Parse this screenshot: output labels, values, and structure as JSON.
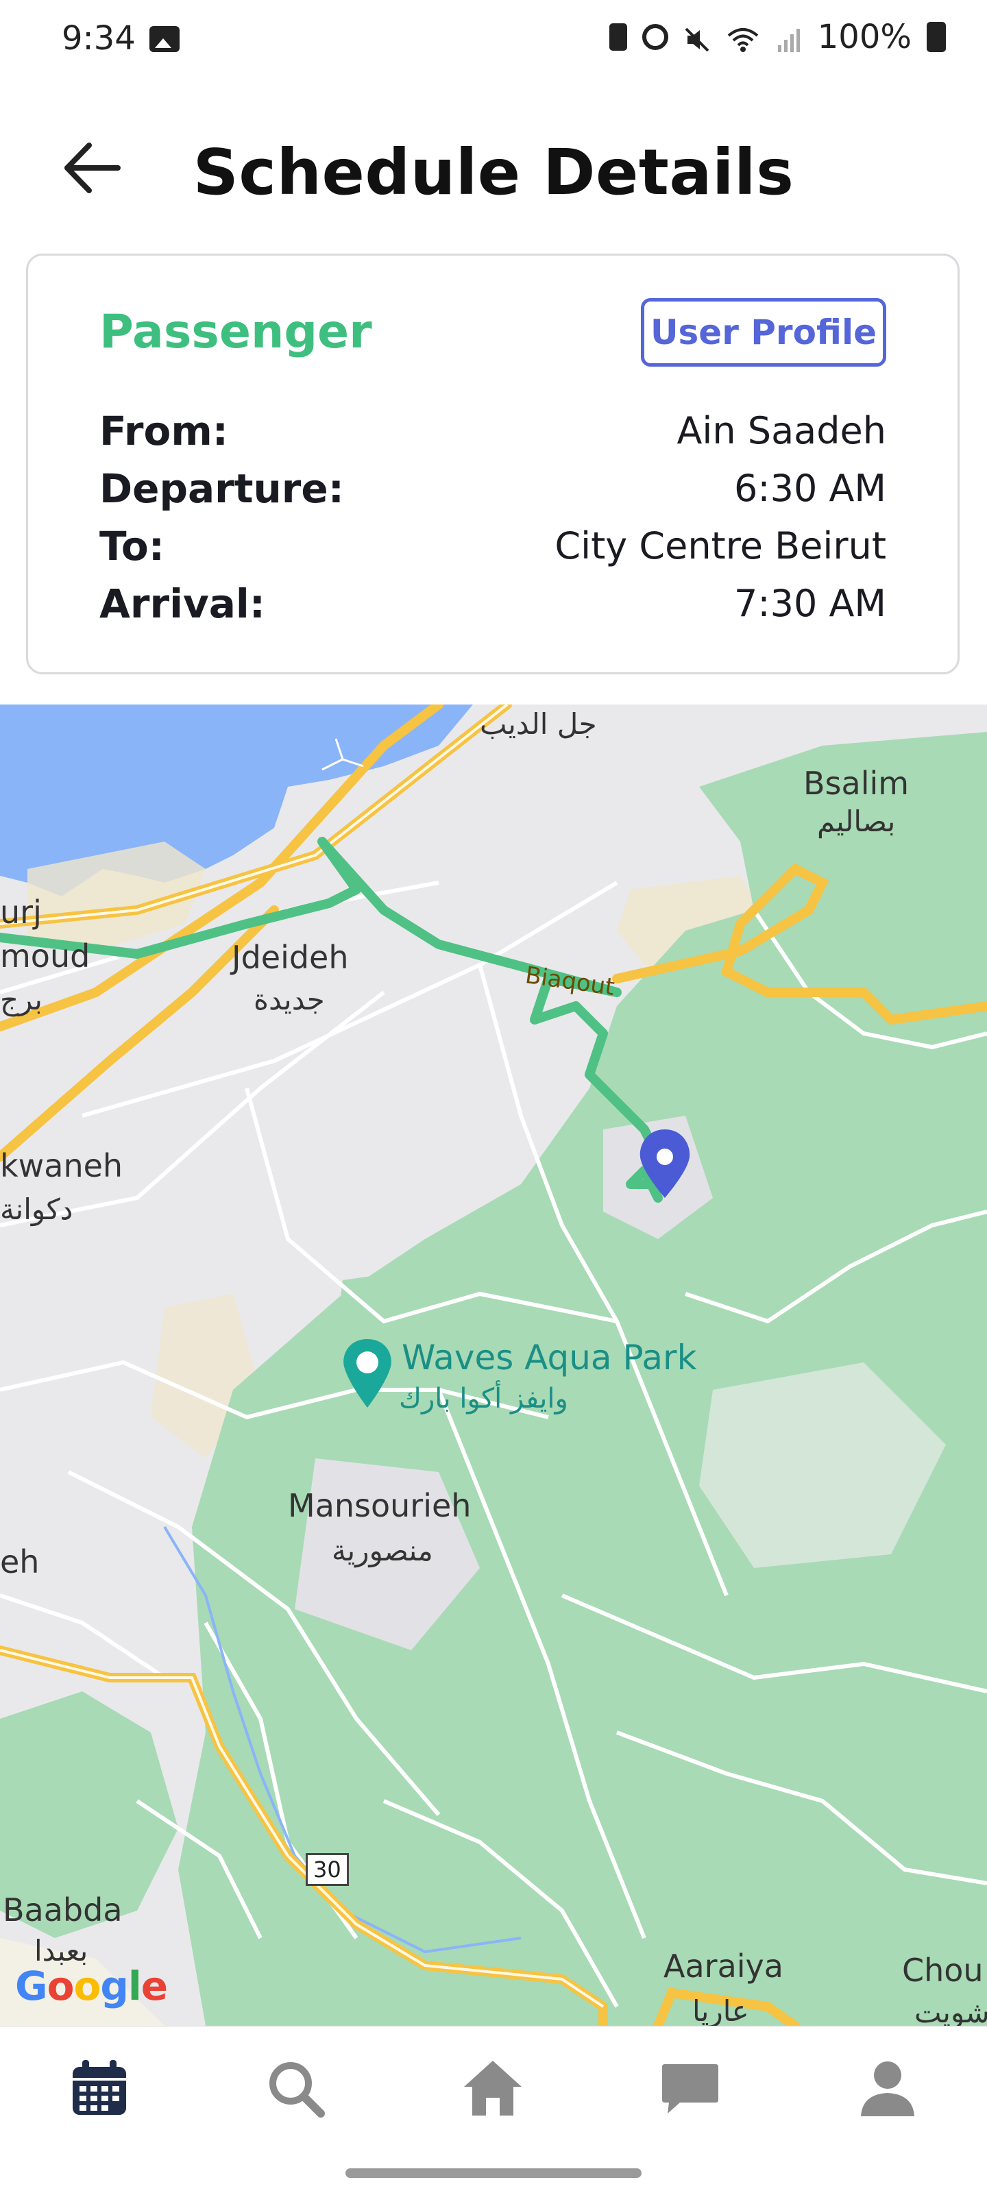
{
  "status_bar": {
    "time": "9:34",
    "battery_percent": "100%",
    "icons": [
      "gallery-icon",
      "battery-saver-icon",
      "alarm-icon",
      "mute-icon",
      "wifi-icon",
      "signal-icon",
      "battery-icon"
    ]
  },
  "header": {
    "title": "Schedule Details",
    "back_icon": "arrow-left-icon"
  },
  "card": {
    "heading": "Passenger",
    "profile_button": "User Profile",
    "rows": [
      {
        "label": "From:",
        "value": "Ain Saadeh"
      },
      {
        "label": "Departure:",
        "value": "6:30 AM"
      },
      {
        "label": "To:",
        "value": "City Centre Beirut"
      },
      {
        "label": "Arrival:",
        "value": "7:30 AM"
      }
    ]
  },
  "map": {
    "labels": {
      "jal_el_dib_ar": "جل الديب",
      "bsalim": "Bsalim",
      "bsalim_ar": "بصاليم",
      "burj_hammoud_1": "urj",
      "burj_hammoud_2": "moud",
      "burj_hammoud_ar": "برج",
      "jdeideh": "Jdeideh",
      "jdeideh_ar": "جديدة",
      "biaqout": "Biaqout",
      "dekwaneh": "kwaneh",
      "dekwaneh_ar": "دكوانة",
      "waves": "Waves Aqua Park",
      "waves_ar": "وايفز أكوا بارك",
      "mansourieh": "Mansourieh",
      "mansourieh_ar": "منصورية",
      "eh": "eh",
      "highway": "30",
      "baabda": "Baabda",
      "baabda_ar": "بعبدا",
      "aaraiya": "Aaraiya",
      "aaraiya_ar": "عاريا",
      "chou": "Chou",
      "chou_ar": "شويت"
    },
    "google": [
      "G",
      "o",
      "o",
      "g",
      "l",
      "e"
    ],
    "colors": {
      "route": "#4fc184",
      "water": "#8ab4f8",
      "park": "#a8dab5",
      "highway": "#f6c343",
      "pin": "#4b5bd6"
    }
  },
  "bottom_nav": {
    "items": [
      "calendar-icon",
      "search-icon",
      "home-icon",
      "chat-icon",
      "profile-icon"
    ],
    "active": "calendar-icon"
  }
}
